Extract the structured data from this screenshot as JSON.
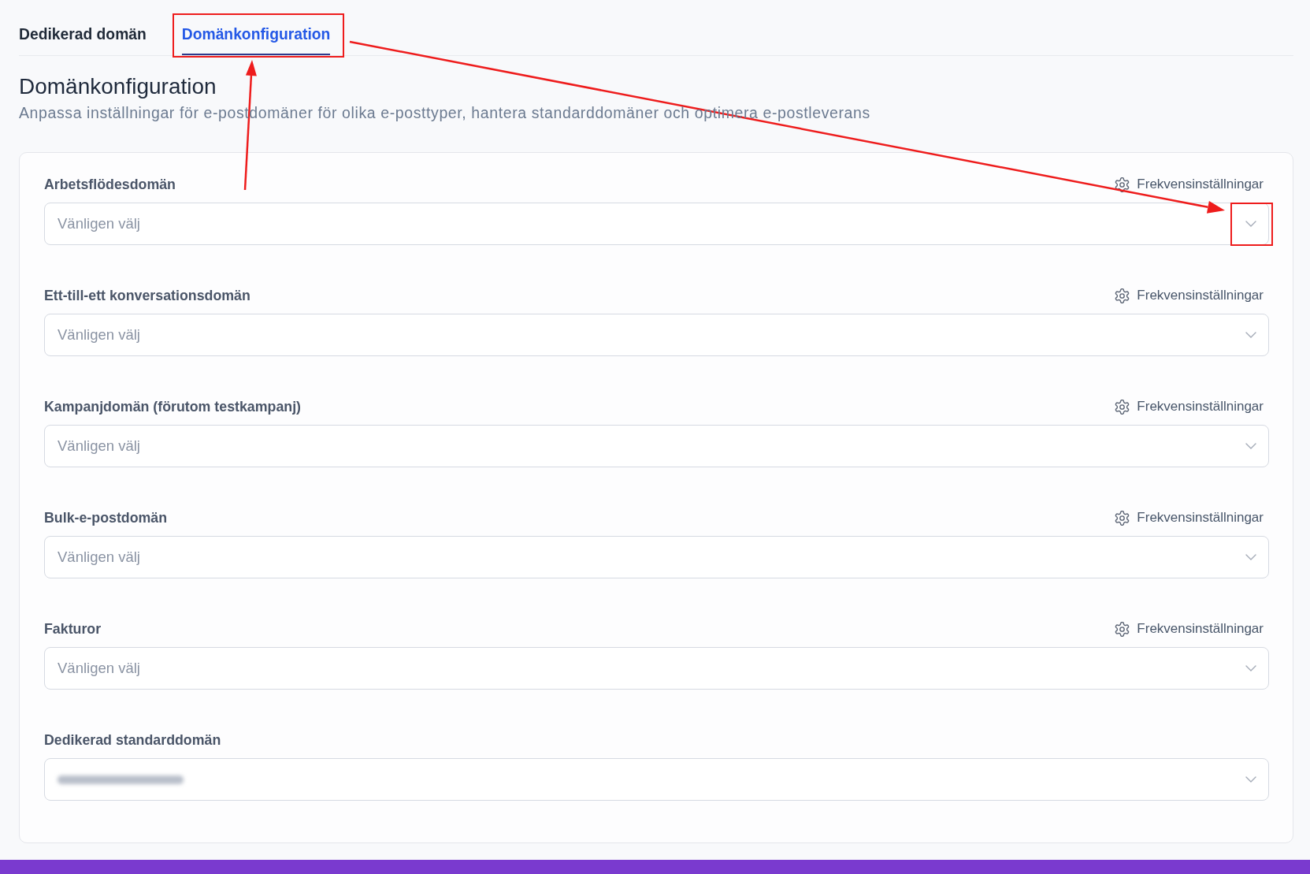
{
  "tabs": [
    {
      "label": "Dedikerad domän",
      "selected": false,
      "highlighted": false
    },
    {
      "label": "Domänkonfiguration",
      "selected": true,
      "highlighted": true
    }
  ],
  "heading": {
    "title": "Domänkonfiguration",
    "subtitle": "Anpassa inställningar för e-postdomäner för olika e-posttyper, hantera standarddomäner och optimera e-postleverans"
  },
  "fields": [
    {
      "label": "Arbetsflödesdomän",
      "settings_link": "Frekvensinställningar",
      "placeholder": "Vänligen välj",
      "chevron_highlighted": true
    },
    {
      "label": "Ett-till-ett konversationsdomän",
      "settings_link": "Frekvensinställningar",
      "placeholder": "Vänligen välj",
      "chevron_highlighted": false
    },
    {
      "label": "Kampanjdomän (förutom testkampanj)",
      "settings_link": "Frekvensinställningar",
      "placeholder": "Vänligen välj",
      "chevron_highlighted": false
    },
    {
      "label": "Bulk-e-postdomän",
      "settings_link": "Frekvensinställningar",
      "placeholder": "Vänligen välj",
      "chevron_highlighted": false
    },
    {
      "label": "Fakturor",
      "settings_link": "Frekvensinställningar",
      "placeholder": "Vänligen välj",
      "chevron_highlighted": false
    },
    {
      "label": "Dedikerad standarddomän",
      "value_blurred": true,
      "chevron_highlighted": false
    }
  ]
}
